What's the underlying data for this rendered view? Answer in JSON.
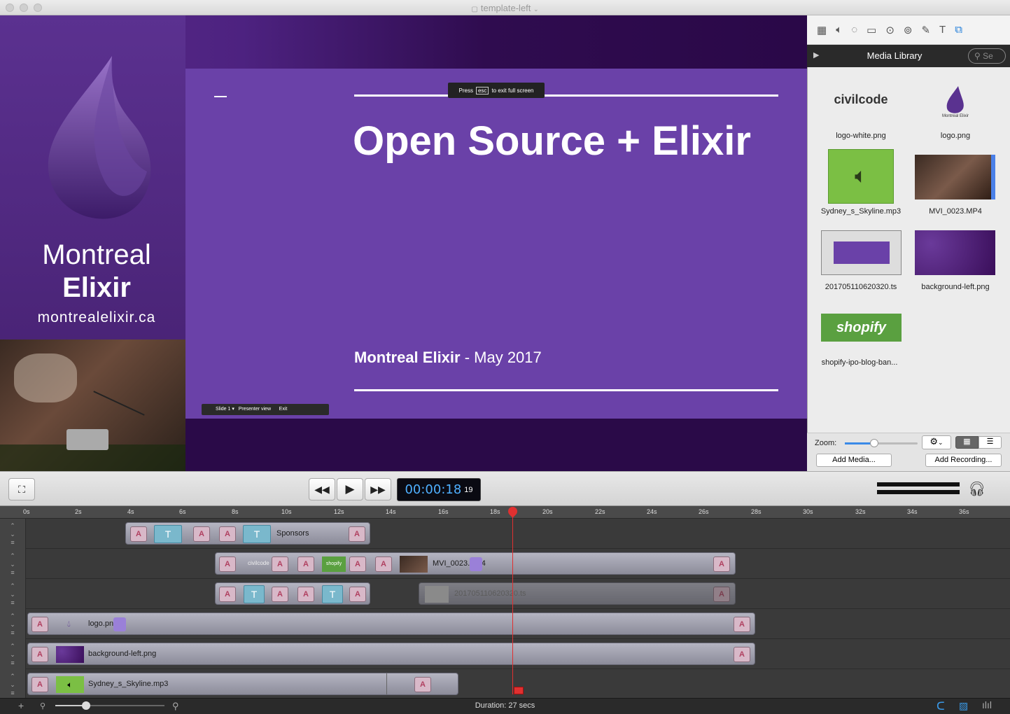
{
  "window": {
    "title": "template-left"
  },
  "slide": {
    "title": "Open Source + Elixir",
    "subtitle_bold": "Montreal Elixir",
    "subtitle_rest": " - May 2017",
    "esc_hint_pre": "Press",
    "esc_key": "esc",
    "esc_hint_post": "to exit full screen",
    "pres_bar": "Slide 1 ▾   Presenter view      Exit"
  },
  "brand": {
    "line1": "Montreal",
    "line2": "Elixir",
    "url": "montrealelixir.ca"
  },
  "sidebar": {
    "library_title": "Media Library",
    "search_placeholder": "Se",
    "items": [
      {
        "label": "logo-white.png",
        "thumb_text": "civilcode"
      },
      {
        "label": "logo.png",
        "thumb_text": "Montreal Elixir"
      },
      {
        "label": "Sydney_s_Skyline.mp3"
      },
      {
        "label": "MVI_0023.MP4"
      },
      {
        "label": "201705110620320.ts"
      },
      {
        "label": "background-left.png"
      },
      {
        "label": "shopify-ipo-blog-ban...",
        "thumb_text": "shopify"
      }
    ],
    "zoom_label": "Zoom:",
    "add_media": "Add Media...",
    "add_recording": "Add Recording..."
  },
  "controls": {
    "time_main": "00:00:18",
    "time_frames": "19"
  },
  "ruler": [
    "0s",
    "2s",
    "4s",
    "6s",
    "8s",
    "10s",
    "12s",
    "14s",
    "16s",
    "18s",
    "20s",
    "22s",
    "24s",
    "26s",
    "28s",
    "30s",
    "32s",
    "34s",
    "36s"
  ],
  "tracks": {
    "t1_label": "Sponsors",
    "t2_label": "MVI_0023.MP4",
    "t3_label": "201705110620320.ts",
    "t4_label": "logo.png",
    "t5_label": "background-left.png",
    "t6_label": "Sydney_s_Skyline.mp3",
    "t2_thumb_text": "civilcode",
    "shopify_text": "shopify"
  },
  "status": {
    "duration": "Duration: 27 secs"
  },
  "colors": {
    "accent": "#6a41a8",
    "playhead": "#e03030",
    "timecode": "#4fb0ff"
  }
}
